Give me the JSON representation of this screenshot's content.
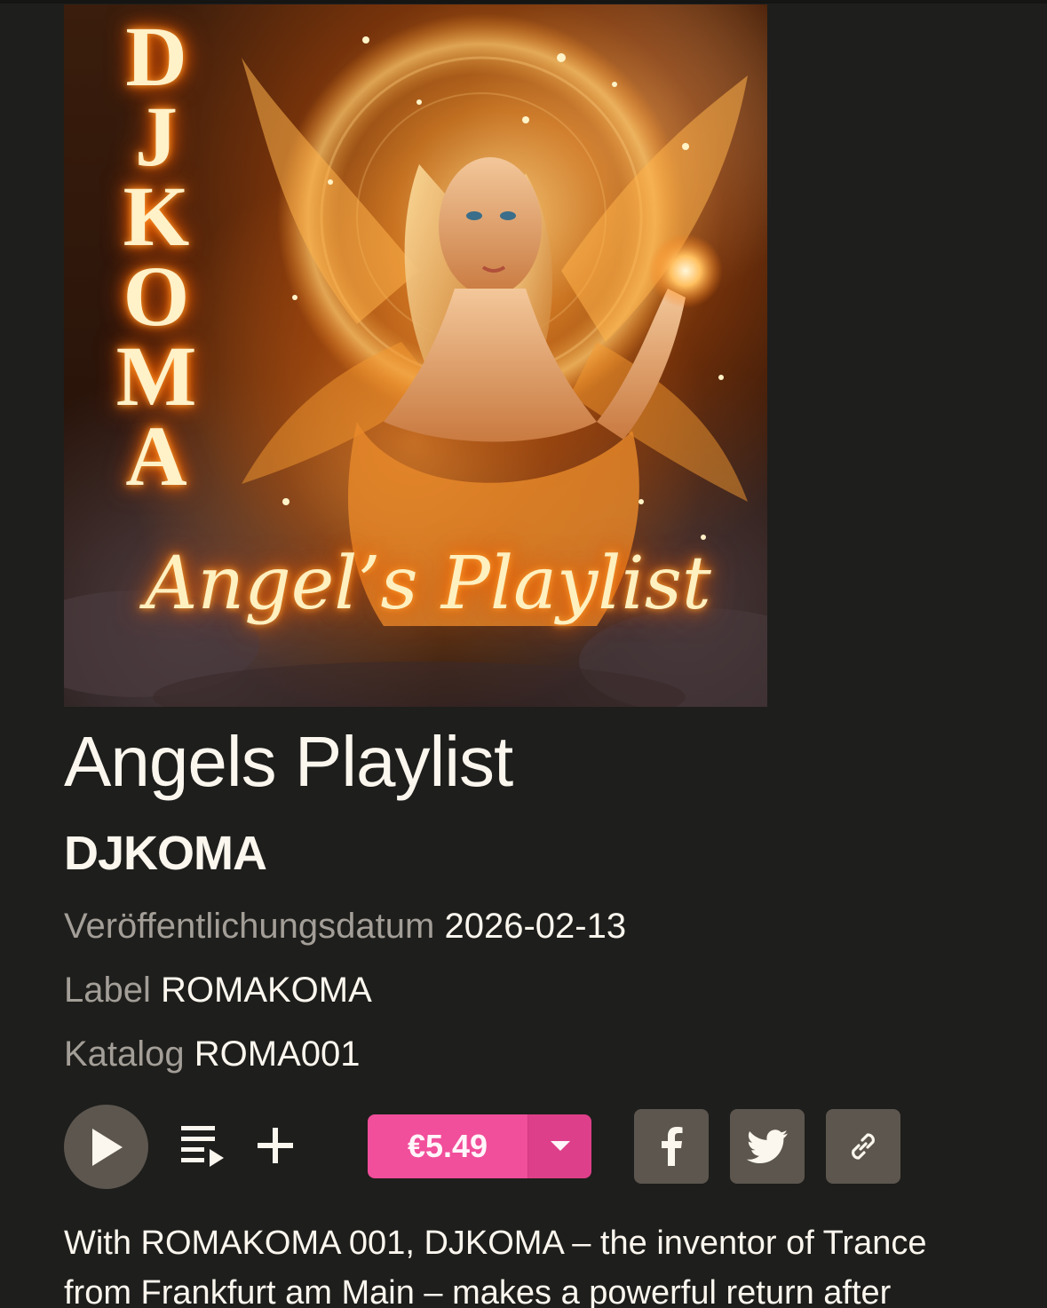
{
  "artwork": {
    "vertical_text": "D\nJ\nK\nO\nM\nA",
    "script_text": "Angel’s Playlist",
    "glow_color": "#ff7a10"
  },
  "release": {
    "title": "Angels Playlist",
    "artist": "DJKOMA",
    "release_date_label": "Veröffentlichungsdatum",
    "release_date": "2026-02-13",
    "label_label": "Label",
    "label": "ROMAKOMA",
    "catalog_label": "Katalog",
    "catalog": "ROMA001"
  },
  "controls": {
    "play_icon": "play-icon",
    "queue_icon": "add-to-queue-icon",
    "add_icon": "plus-icon",
    "price": "€5.49",
    "price_color": "#f14e9b",
    "caret_icon": "chevron-down-icon"
  },
  "share": {
    "facebook_icon": "facebook-icon",
    "twitter_icon": "twitter-icon",
    "link_icon": "link-icon"
  },
  "description": {
    "text": "With ROMAKOMA 001, DJKOMA – the inventor of Trance from Frankfurt am Main – makes a powerful return after"
  }
}
